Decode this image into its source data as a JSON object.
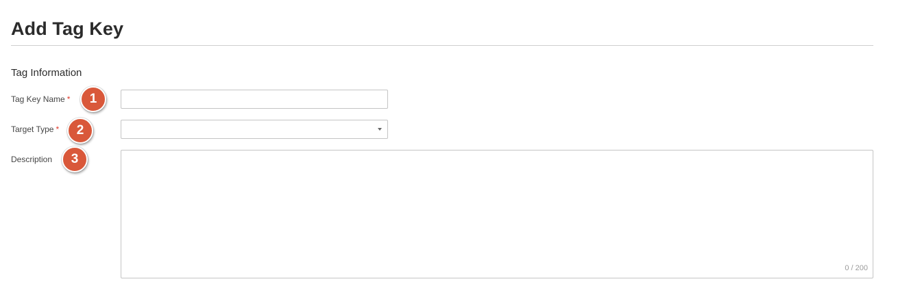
{
  "page": {
    "title": "Add Tag Key"
  },
  "section": {
    "title": "Tag Information"
  },
  "fields": {
    "tag_key_name": {
      "label": "Tag Key Name",
      "required_mark": "*",
      "value": ""
    },
    "target_type": {
      "label": "Target Type",
      "required_mark": "*",
      "selected": ""
    },
    "description": {
      "label": "Description",
      "value": "",
      "counter": "0 / 200"
    }
  },
  "badges": [
    "1",
    "2",
    "3"
  ],
  "colors": {
    "badge": "#d9583a",
    "required": "#e0382b",
    "border": "#c4c4c4"
  },
  "icons": {
    "select_caret": "caret-down-icon"
  }
}
